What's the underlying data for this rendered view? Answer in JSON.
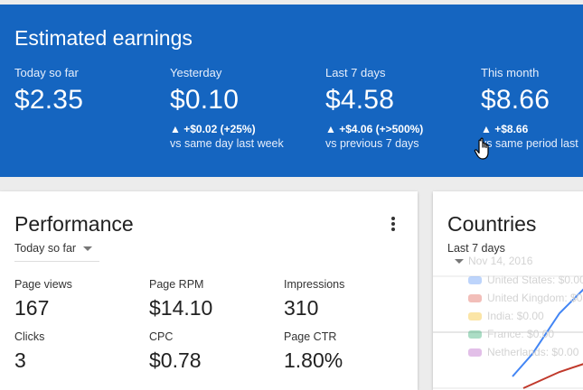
{
  "earnings": {
    "title": "Estimated earnings",
    "stats": [
      {
        "label": "Today so far",
        "value": "$2.35",
        "change": "",
        "compare": ""
      },
      {
        "label": "Yesterday",
        "value": "$0.10",
        "change": "▲ +$0.02 (+25%)",
        "compare": "vs same day last week"
      },
      {
        "label": "Last 7 days",
        "value": "$4.58",
        "change": "▲ +$4.06 (+>500%)",
        "compare": "vs previous 7 days"
      },
      {
        "label": "This month",
        "value": "$8.66",
        "change": "▲ +$8.66",
        "compare": "vs same period last"
      }
    ]
  },
  "performance": {
    "title": "Performance",
    "range": "Today so far",
    "metrics": [
      {
        "label": "Page views",
        "value": "167"
      },
      {
        "label": "Page RPM",
        "value": "$14.10"
      },
      {
        "label": "Impressions",
        "value": "310"
      },
      {
        "label": "Clicks",
        "value": "3"
      },
      {
        "label": "CPC",
        "value": "$0.78"
      },
      {
        "label": "Page CTR",
        "value": "1.80%"
      }
    ]
  },
  "countries": {
    "title": "Countries",
    "range": "Last 7 days",
    "tooltip_date": "Nov 14, 2016",
    "legend": [
      {
        "label": "United States: $0.00",
        "color": "#4285f4"
      },
      {
        "label": "United Kingdom: $0.00",
        "color": "#db4437"
      },
      {
        "label": "India: $0.00",
        "color": "#f4b400"
      },
      {
        "label": "France: $0.00",
        "color": "#0f9d58"
      },
      {
        "label": "Netherlands: $0.00",
        "color": "#ab47bc"
      }
    ]
  },
  "colors": {
    "header_bg": "#1565c0",
    "page_bg": "#ececec"
  }
}
